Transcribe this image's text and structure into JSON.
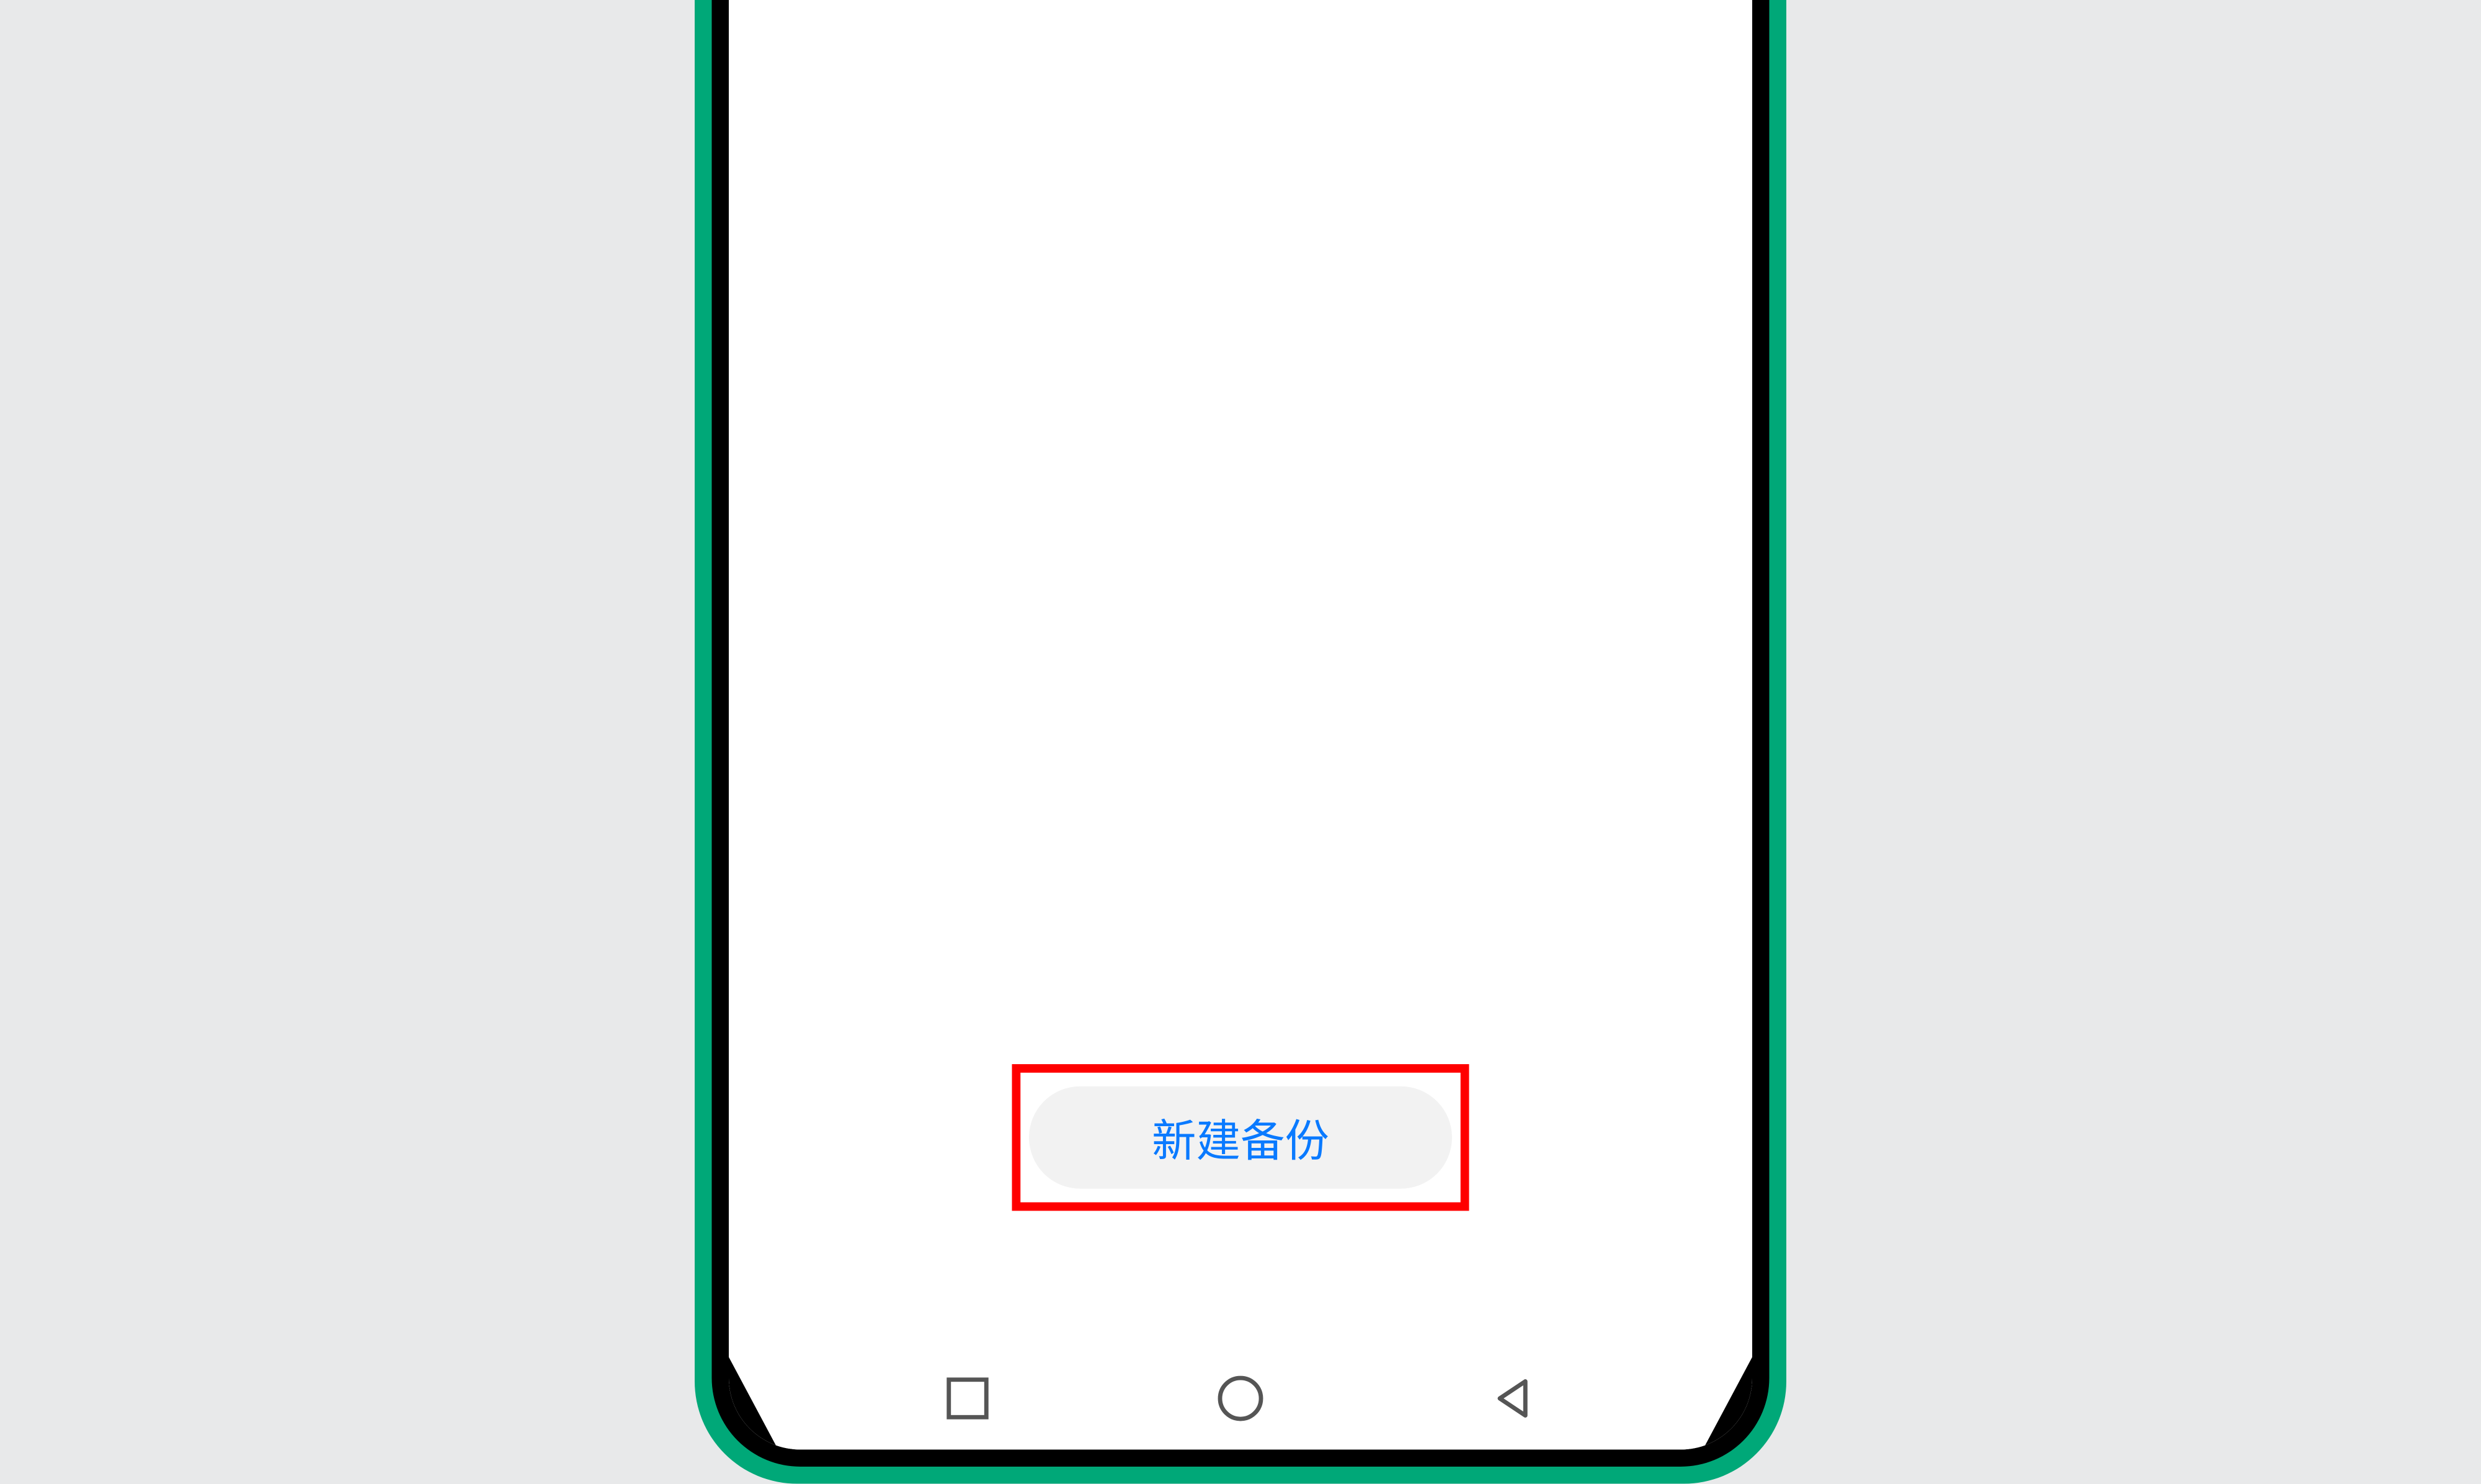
{
  "button": {
    "new_backup_label": "新建备份"
  },
  "colors": {
    "highlight_border": "#ff0000",
    "button_text": "#0a7aff",
    "button_bg": "#f2f2f2",
    "phone_accent": "#00a878"
  },
  "nav": {
    "recent": "recent-apps",
    "home": "home",
    "back": "back"
  }
}
